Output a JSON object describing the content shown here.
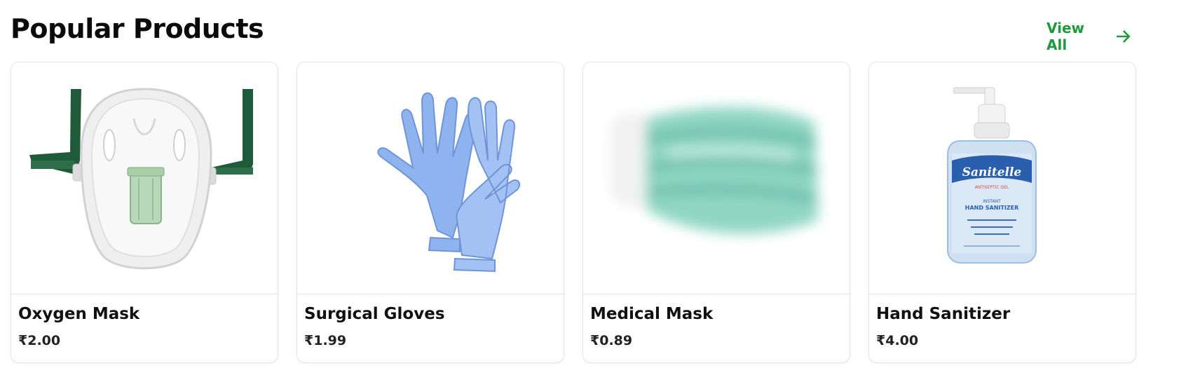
{
  "section": {
    "title": "Popular Products",
    "view_all_label": "View All"
  },
  "products": [
    {
      "name": "Oxygen Mask",
      "price": "₹2.00",
      "image": "oxygen-mask"
    },
    {
      "name": "Surgical Gloves",
      "price": "₹1.99",
      "image": "surgical-gloves"
    },
    {
      "name": "Medical Mask",
      "price": "₹0.89",
      "image": "medical-mask"
    },
    {
      "name": "Hand Sanitizer",
      "price": "₹4.00",
      "image": "hand-sanitizer"
    }
  ],
  "image_text": {
    "brand": "Sanitelle",
    "sub": "ANTISEPTIC GEL",
    "line1": "INSTANT",
    "line2": "HAND SANITIZER"
  },
  "colors": {
    "accent": "#1e9a3e",
    "card_border": "#e6e6e6"
  },
  "icons": {
    "view_all": "arrow-right-icon"
  }
}
